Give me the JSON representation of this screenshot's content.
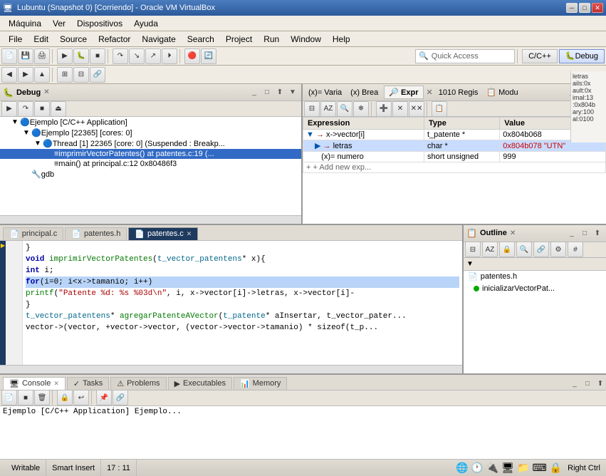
{
  "window": {
    "title": "Lubuntu (Snapshot 0) [Corriendo] - Oracle VM VirtualBox",
    "min_btn": "─",
    "max_btn": "□",
    "close_btn": "✕"
  },
  "os_menu": {
    "items": [
      "Máquina",
      "Ver",
      "Dispositivos",
      "Ayuda"
    ]
  },
  "app_menu": {
    "items": [
      "File",
      "Edit",
      "Source",
      "Refactor",
      "Navigate",
      "Search",
      "Project",
      "Run",
      "Window",
      "Help"
    ]
  },
  "quick_access": {
    "placeholder": "Quick Access"
  },
  "perspective": {
    "cpp_label": "C/C++",
    "debug_label": "Debug"
  },
  "debug_panel": {
    "title": "Debug",
    "close_icon": "✕",
    "tree": [
      {
        "level": 0,
        "arrow": "▼",
        "icon": "🔵",
        "text": "Ejemplo [C/C++ Application]"
      },
      {
        "level": 1,
        "arrow": "▼",
        "icon": "🔵",
        "text": "Ejemplo [22365] [cores: 0]"
      },
      {
        "level": 2,
        "arrow": "▼",
        "icon": "🔵",
        "text": "Thread [1] 22365 [core: 0] (Suspended : Breakp..."
      },
      {
        "level": 3,
        "arrow": "",
        "icon": "=",
        "text": "imprimirVectorPatentes() at patentes.c:19 (...",
        "selected": true
      },
      {
        "level": 3,
        "arrow": "",
        "icon": "=",
        "text": "main() at principal.c:12 0x80486f3"
      },
      {
        "level": 1,
        "arrow": "",
        "icon": "🔧",
        "text": "gdb"
      }
    ]
  },
  "expr_panel": {
    "tabs": [
      {
        "label": "(x)= Varia",
        "active": false
      },
      {
        "label": "(x) Brea",
        "active": false
      },
      {
        "label": "🔎 Expr",
        "active": true
      },
      {
        "label": "1010 Regis",
        "active": false
      },
      {
        "label": "📋 Modu",
        "active": false
      }
    ],
    "columns": [
      "Expression",
      "Type",
      "Value"
    ],
    "rows": [
      {
        "expand": "▼",
        "arrow": "→",
        "expression": "x->vector[i]",
        "type": "t_patente *",
        "value": "0x804b068",
        "selected": false,
        "indent": 0
      },
      {
        "expand": "▶",
        "arrow": "→",
        "expression": "letras",
        "type": "char *",
        "value": "0x804b078 \"UTN\"",
        "selected": true,
        "indent": 1
      },
      {
        "expand": "",
        "arrow": "",
        "expression": "numero",
        "type": "short unsigned",
        "value": "999",
        "selected": false,
        "indent": 1
      }
    ],
    "add_new": "+ Add new exp..."
  },
  "right_sidebar": {
    "labels": [
      "letras",
      "ails:0x",
      "ault:0x",
      "imal:13",
      ":0x804b",
      "ary:100",
      "al:0100"
    ]
  },
  "editor_tabs": [
    {
      "label": "principal.c",
      "icon": "📄",
      "active": false
    },
    {
      "label": "patentes.h",
      "icon": "📄",
      "active": false
    },
    {
      "label": "patentes.c",
      "icon": "📄",
      "active": true
    }
  ],
  "code": {
    "lines": [
      {
        "num": "",
        "text": "    }"
      },
      {
        "num": "",
        "text": "    void imprimirVectorPatentes(t_vector_patentens* x){",
        "highlight": false
      },
      {
        "num": "",
        "text": "        int i;",
        "highlight": false
      },
      {
        "num": "",
        "text": "        for(i=0; i<x->tamanio; i++)",
        "highlight": true
      },
      {
        "num": "",
        "text": "            printf(\"Patente %d: %s %03d\\n\", i, x->vector[i]->letras, x->vector[i]-",
        "highlight": false
      },
      {
        "num": "",
        "text": "    }",
        "highlight": false
      },
      {
        "num": "",
        "text": "    t_vector_patentens* agregarPatenteAVector(t_patente* aInsertar, t_vector_pater...",
        "highlight": false
      },
      {
        "num": "",
        "text": "        vector->(vector, +vector->vector, (vector->vector->tamanio) * sizeof(t_p...",
        "highlight": false
      }
    ]
  },
  "outline_panel": {
    "title": "Outline",
    "items": [
      {
        "icon": "📄",
        "color": "#0000cc",
        "text": "patentes.h"
      },
      {
        "icon": "●",
        "color": "#00aa00",
        "text": "inicializarVectorPat..."
      }
    ]
  },
  "console_panel": {
    "tabs": [
      {
        "label": "Console",
        "icon": "🖥",
        "active": true
      },
      {
        "label": "Tasks",
        "icon": "✓",
        "active": false
      },
      {
        "label": "Problems",
        "icon": "⚠",
        "active": false
      },
      {
        "label": "Executables",
        "icon": "▶",
        "active": false
      },
      {
        "label": "Memory",
        "icon": "📊",
        "active": false
      }
    ],
    "content": "Ejemplo [C/C++ Application] Ejemplo..."
  },
  "status_bar": {
    "writable": "Writable",
    "insert_mode": "Smart Insert",
    "position": "17 : 11",
    "right_label": "Right Ctrl"
  }
}
